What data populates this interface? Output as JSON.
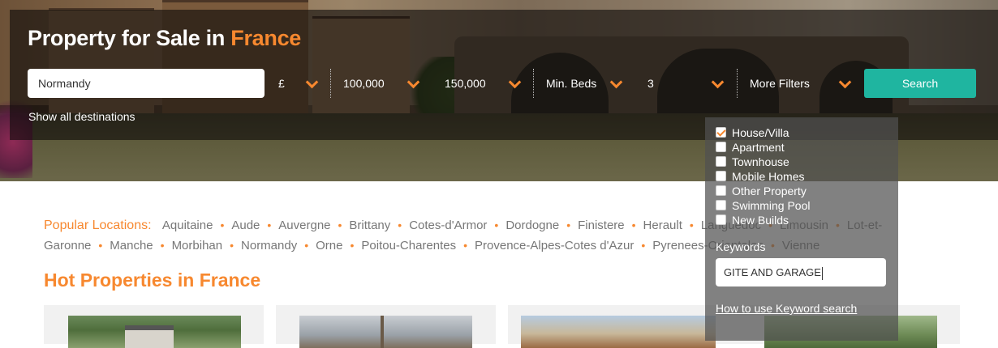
{
  "hero": {
    "title_main": "Property for Sale in ",
    "title_accent": "France",
    "location_input": {
      "value": "Normandy"
    },
    "currency": {
      "value": "£"
    },
    "min_price": {
      "value": "100,000"
    },
    "max_price": {
      "value": "150,000"
    },
    "min_beds": {
      "value": "Min. Beds"
    },
    "beds": {
      "value": "3"
    },
    "more_filters": {
      "value": "More Filters"
    },
    "search_label": "Search",
    "show_all": "Show all destinations"
  },
  "filters": {
    "options": [
      {
        "label": "House/Villa",
        "checked": true
      },
      {
        "label": "Apartment",
        "checked": false
      },
      {
        "label": "Townhouse",
        "checked": false
      },
      {
        "label": "Mobile Homes",
        "checked": false
      },
      {
        "label": "Other Property",
        "checked": false
      },
      {
        "label": "Swimming Pool",
        "checked": false
      },
      {
        "label": "New Builds",
        "checked": false
      }
    ],
    "keywords_label": "Keywords",
    "keywords_value": "GITE AND GARAGE",
    "help_link": "How to use Keyword search"
  },
  "popular": {
    "label": "Popular Locations:",
    "locations": [
      "Aquitaine",
      "Aude",
      "Auvergne",
      "Brittany",
      "Cotes-d'Armor",
      "Dordogne",
      "Finistere",
      "Herault",
      "Languedoc",
      "Limousin",
      "Lot-et-Garonne",
      "Manche",
      "Morbihan",
      "Normandy",
      "Orne",
      "Poitou-Charentes",
      "Provence-Alpes-Cotes d'Azur",
      "Pyrenees-Orientales",
      "Vienne"
    ]
  },
  "hot": {
    "title": "Hot Properties in France"
  },
  "colors": {
    "accent": "#f7882f",
    "button": "#1fb5a0"
  },
  "icons": {
    "dropdown": "chevron-down-icon",
    "checkbox": "checkbox-icon"
  }
}
